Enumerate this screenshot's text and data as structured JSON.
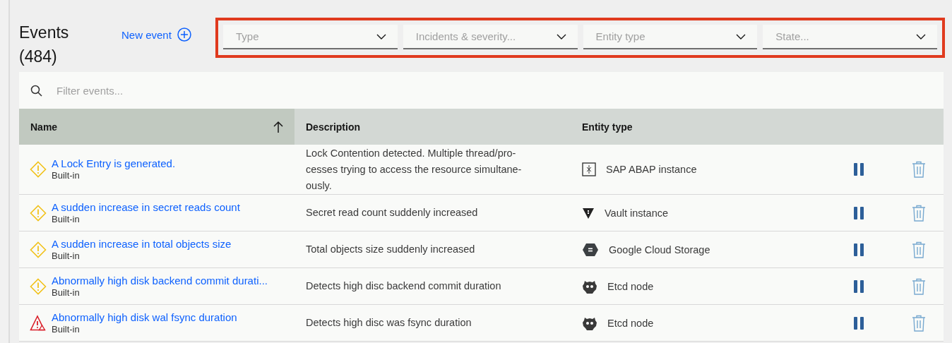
{
  "header": {
    "title": "Events",
    "count": "(484)",
    "new_button": "New event"
  },
  "filters": {
    "highlighted": true,
    "items": [
      {
        "placeholder": "Type"
      },
      {
        "placeholder": "Incidents & severity..."
      },
      {
        "placeholder": "Entity type"
      },
      {
        "placeholder": "State..."
      }
    ]
  },
  "search": {
    "placeholder": "Filter events..."
  },
  "table": {
    "columns": [
      {
        "label": "Name",
        "sorted": true
      },
      {
        "label": "Description",
        "sorted": false
      },
      {
        "label": "Entity type",
        "sorted": false
      }
    ],
    "rows": [
      {
        "kind": "warning",
        "name": "A Lock Entry is generated.",
        "origin": "Built-in",
        "description": "Lock Contention detected. Multiple thread/pro-\ncesses trying to access the resource simultane-\nously.",
        "entity": {
          "kind": "sap",
          "label": "SAP ABAP instance"
        }
      },
      {
        "kind": "warning",
        "name": "A sudden increase in secret reads count",
        "origin": "Built-in",
        "description": "Secret read count suddenly increased",
        "entity": {
          "kind": "vault",
          "label": "Vault instance"
        }
      },
      {
        "kind": "warning",
        "name": "A sudden increase in total objects size",
        "origin": "Built-in",
        "description": "Total objects size suddenly increased",
        "entity": {
          "kind": "storage",
          "label": "Google Cloud Storage"
        }
      },
      {
        "kind": "warning",
        "name": "Abnormally high disk backend commit durati...",
        "origin": "Built-in",
        "description": "Detects high disc backend commit duration",
        "entity": {
          "kind": "etcd",
          "label": "Etcd node"
        }
      },
      {
        "kind": "critical",
        "name": "Abnormally high disk wal fsync duration",
        "origin": "Built-in",
        "description": "Detects high disc was fsync duration",
        "entity": {
          "kind": "etcd",
          "label": "Etcd node"
        }
      }
    ]
  }
}
